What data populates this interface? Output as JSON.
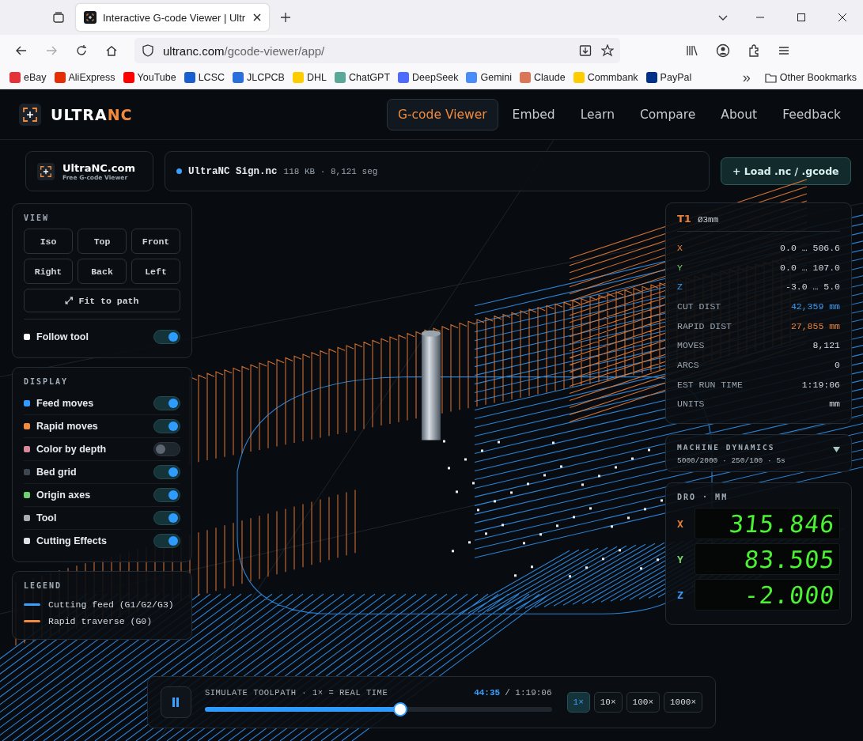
{
  "browser": {
    "tab_title": "Interactive G-code Viewer | Ultr",
    "url_host": "ultranc.com",
    "url_path": "/gcode-viewer/app/",
    "bookmarks": [
      {
        "label": "eBay",
        "color": "#e53238"
      },
      {
        "label": "AliExpress",
        "color": "#e62e04"
      },
      {
        "label": "YouTube",
        "color": "#ff0000"
      },
      {
        "label": "LCSC",
        "color": "#1a5fd0"
      },
      {
        "label": "JLCPCB",
        "color": "#2a6fdc"
      },
      {
        "label": "DHL",
        "color": "#ffcc00"
      },
      {
        "label": "ChatGPT",
        "color": "#5aa897"
      },
      {
        "label": "DeepSeek",
        "color": "#4d6bfe"
      },
      {
        "label": "Gemini",
        "color": "#4b8df8"
      },
      {
        "label": "Claude",
        "color": "#d97757"
      },
      {
        "label": "Commbank",
        "color": "#ffcc00"
      },
      {
        "label": "PayPal",
        "color": "#003087"
      }
    ],
    "other_bookmarks": "Other Bookmarks",
    "overflow": "»"
  },
  "app": {
    "logo_main": "ULTRA",
    "logo_accent": "NC",
    "nav": [
      {
        "label": "G-code Viewer",
        "selected": true
      },
      {
        "label": "Embed",
        "selected": false
      },
      {
        "label": "Learn",
        "selected": false
      },
      {
        "label": "Compare",
        "selected": false
      },
      {
        "label": "About",
        "selected": false
      },
      {
        "label": "Feedback",
        "selected": false
      }
    ],
    "brand_card": {
      "title": "UltraNC.com",
      "subtitle": "Free G-code Viewer"
    },
    "file": {
      "name": "UltraNC Sign.nc",
      "meta": "118 KB · 8,121 seg"
    },
    "load_button": "+ Load .nc / .gcode",
    "view_panel": {
      "heading": "VIEW",
      "buttons": [
        "Iso",
        "Top",
        "Front",
        "Right",
        "Back",
        "Left"
      ],
      "fit_button": "⤢ Fit to path",
      "follow": {
        "label": "Follow tool",
        "on": true
      }
    },
    "display_panel": {
      "heading": "DISPLAY",
      "items": [
        {
          "label": "Feed moves",
          "color": "#3399ff",
          "on": true
        },
        {
          "label": "Rapid moves",
          "color": "#f08a3c",
          "on": true
        },
        {
          "label": "Color by depth",
          "color": "#d98a9a",
          "on": false
        },
        {
          "label": "Bed grid",
          "color": "#3d4752",
          "on": true
        },
        {
          "label": "Origin axes",
          "color": "#6fd06f",
          "on": true
        },
        {
          "label": "Tool",
          "color": "#a7adb5",
          "on": true
        },
        {
          "label": "Cutting Effects",
          "color": "#dfe3e8",
          "on": true
        }
      ]
    },
    "legend": {
      "heading": "LEGEND",
      "items": [
        {
          "label": "Cutting feed (G1/G2/G3)",
          "color": "#3aa0ff"
        },
        {
          "label": "Rapid traverse (G0)",
          "color": "#f08a3c"
        }
      ]
    },
    "stats": {
      "tool": "T1",
      "diameter": "Ø3mm",
      "rows": [
        {
          "label": "X",
          "value": "0.0 … 506.6",
          "kind": "x"
        },
        {
          "label": "Y",
          "value": "0.0 … 107.0",
          "kind": "y"
        },
        {
          "label": "Z",
          "value": "-3.0 … 5.0",
          "kind": "z"
        },
        {
          "label": "CUT DIST",
          "value": "42,359 mm",
          "kind": "cut"
        },
        {
          "label": "RAPID DIST",
          "value": "27,855 mm",
          "kind": "rapid"
        },
        {
          "label": "MOVES",
          "value": "8,121",
          "kind": "plain"
        },
        {
          "label": "ARCS",
          "value": "0",
          "kind": "plain"
        },
        {
          "label": "EST RUN TIME",
          "value": "1:19:06",
          "kind": "plain"
        },
        {
          "label": "UNITS",
          "value": "mm",
          "kind": "plain"
        }
      ]
    },
    "dynamics": {
      "title": "MACHINE DYNAMICS",
      "summary": "5000/2000 · 250/100 · 5s",
      "expanded": false
    },
    "dro": {
      "heading": "DRO · MM",
      "axes": [
        {
          "axis": "X",
          "value": "315.846",
          "color": "#e8803a"
        },
        {
          "axis": "Y",
          "value": "83.505",
          "color": "#7ad36a"
        },
        {
          "axis": "Z",
          "value": "-2.000",
          "color": "#3a9cf5"
        }
      ]
    },
    "simulate": {
      "label": "SIMULATE TOOLPATH · 1× = REAL TIME",
      "elapsed": "44:35",
      "total": "/ 1:19:06",
      "level": 0.564,
      "playing": true,
      "speeds": [
        {
          "label": "1×",
          "selected": true
        },
        {
          "label": "10×",
          "selected": false
        },
        {
          "label": "100×",
          "selected": false
        },
        {
          "label": "1000×",
          "selected": false
        }
      ]
    }
  }
}
